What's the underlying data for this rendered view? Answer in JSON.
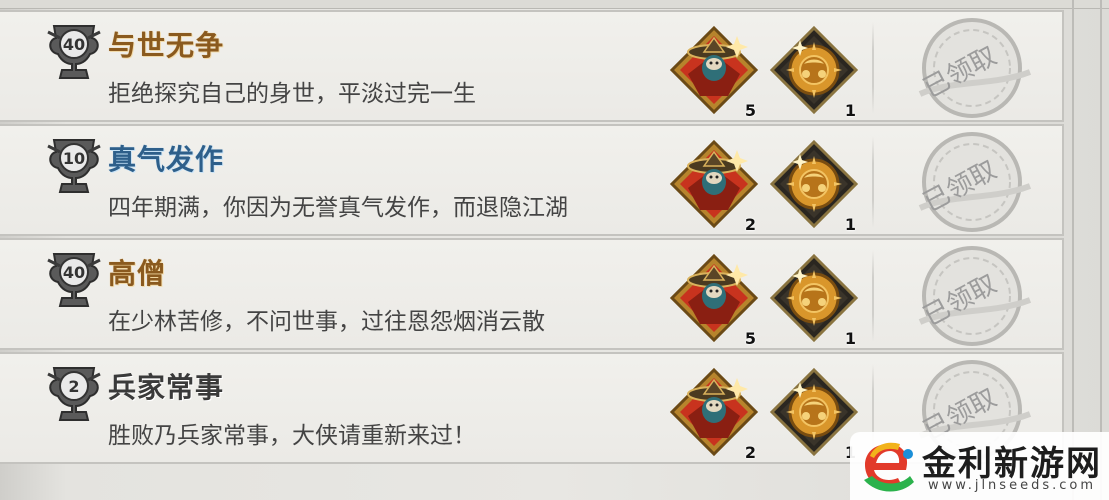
{
  "achievements": [
    {
      "level": "40",
      "title": "与世无争",
      "title_style": "gold",
      "description": "拒绝探究自己的身世，平淡过完一生",
      "rewards": [
        {
          "icon": "hat-character-icon",
          "count": "5"
        },
        {
          "icon": "gold-gear-icon",
          "count": "1"
        }
      ],
      "status": "已领取"
    },
    {
      "level": "10",
      "title": "真气发作",
      "title_style": "blue",
      "description": "四年期满，你因为无誉真气发作，而退隐江湖",
      "rewards": [
        {
          "icon": "hat-character-icon",
          "count": "2"
        },
        {
          "icon": "gold-gear-icon",
          "count": "1"
        }
      ],
      "status": "已领取"
    },
    {
      "level": "40",
      "title": "高僧",
      "title_style": "gold",
      "description": "在少林苦修，不问世事，过往恩怨烟消云散",
      "rewards": [
        {
          "icon": "hat-character-icon",
          "count": "5"
        },
        {
          "icon": "gold-gear-icon",
          "count": "1"
        }
      ],
      "status": "已领取"
    },
    {
      "level": "2",
      "title": "兵家常事",
      "title_style": "dark",
      "description": "胜败乃兵家常事，大侠请重新来过！",
      "rewards": [
        {
          "icon": "hat-character-icon",
          "count": "2"
        },
        {
          "icon": "gold-gear-icon",
          "count": "1"
        }
      ],
      "status": "已领取"
    }
  ],
  "watermark": {
    "name": "金利新游网",
    "url": "www.jlnseeds.com"
  },
  "colors": {
    "gold_title": "#8a5a1f",
    "blue_title": "#2e5f8a",
    "reward_red": "#c8331e",
    "reward_gold": "#d9962b"
  }
}
